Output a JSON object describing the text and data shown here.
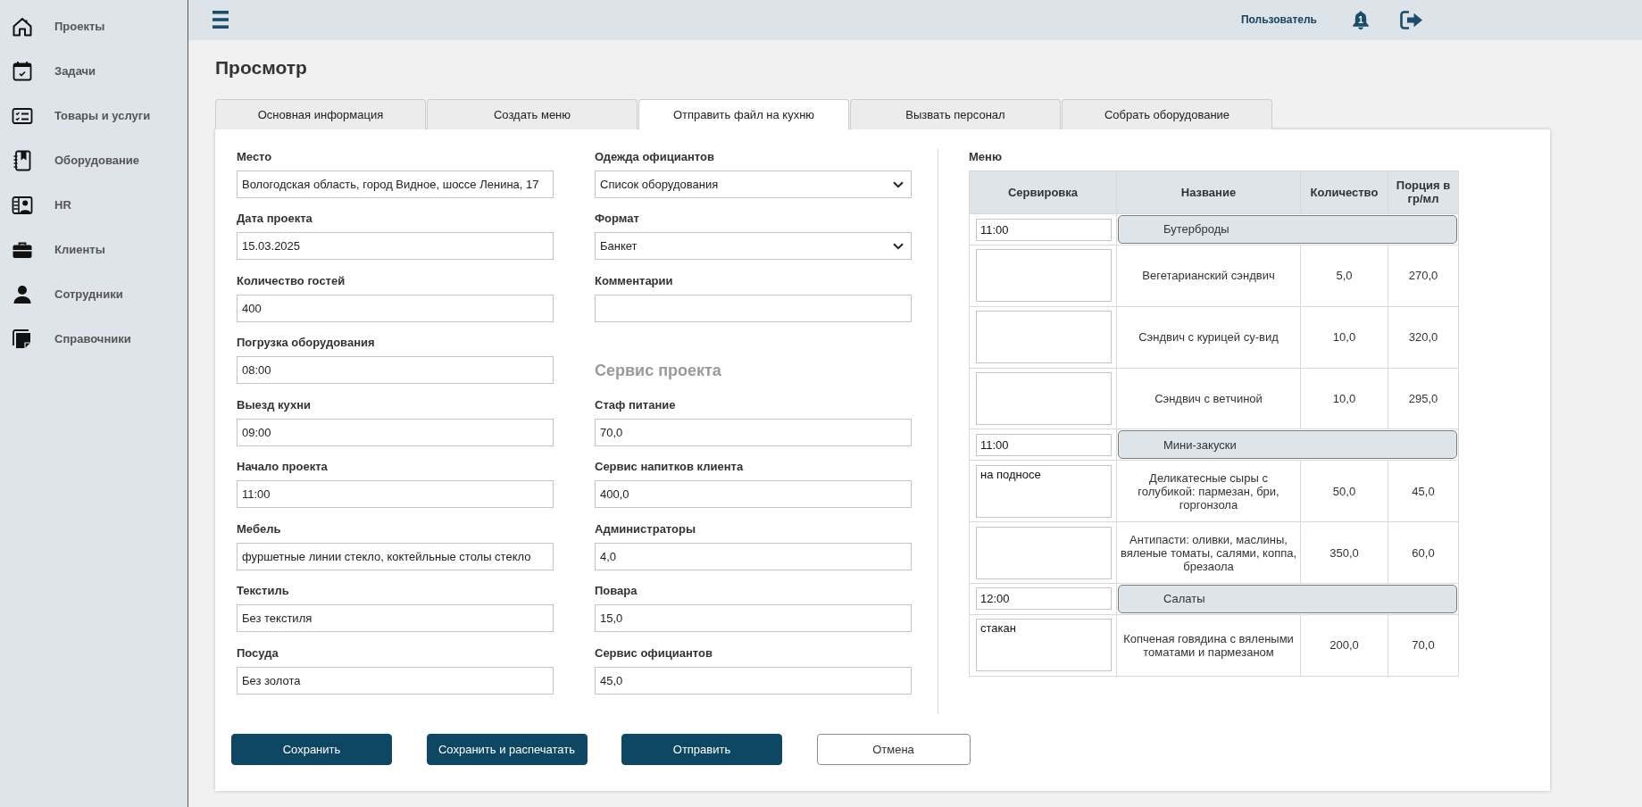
{
  "sidebar": {
    "items": [
      {
        "label": "Проекты"
      },
      {
        "label": "Задачи"
      },
      {
        "label": "Товары и услуги"
      },
      {
        "label": "Оборудование"
      },
      {
        "label": "HR"
      },
      {
        "label": "Клиенты"
      },
      {
        "label": "Сотрудники"
      },
      {
        "label": "Справочники"
      }
    ]
  },
  "topbar": {
    "user": "Пользователь",
    "notifications": "1"
  },
  "page": {
    "title": "Просмотр"
  },
  "tabs": [
    {
      "label": "Основная информация",
      "selected": false
    },
    {
      "label": "Создать меню",
      "selected": false
    },
    {
      "label": "Отправить файл на кухню",
      "selected": true
    },
    {
      "label": "Вызвать персонал",
      "selected": false
    },
    {
      "label": "Собрать оборудование",
      "selected": false
    }
  ],
  "form": {
    "columns": [
      {
        "fields": [
          {
            "kind": "input",
            "label": "Место",
            "value": "Вологодская область, город Видное, шоссе Ленина, 17"
          },
          {
            "kind": "input",
            "label": "Дата проекта",
            "value": "15.03.2025"
          },
          {
            "kind": "input",
            "label": "Количество гостей",
            "value": "400"
          },
          {
            "kind": "input",
            "label": "Погрузка оборудования",
            "value": "08:00"
          },
          {
            "kind": "input",
            "label": "Выезд кухни",
            "value": "09:00"
          },
          {
            "kind": "input",
            "label": "Начало проекта",
            "value": "11:00"
          },
          {
            "kind": "input",
            "label": "Мебель",
            "value": "фуршетные линии стекло, коктейльные столы стекло"
          },
          {
            "kind": "input",
            "label": "Текстиль",
            "value": "Без текстиля"
          },
          {
            "kind": "input",
            "label": "Посуда",
            "value": "Без золота"
          }
        ]
      },
      {
        "fields": [
          {
            "kind": "select",
            "label": "Одежда официантов",
            "value": "Список оборудования"
          },
          {
            "kind": "select",
            "label": "Формат",
            "value": "Банкет"
          },
          {
            "kind": "input",
            "label": "Комментарии"
          },
          {
            "kind": "heading",
            "label": "Сервис проекта"
          },
          {
            "kind": "input",
            "label": "Стаф питание",
            "value": "70,0"
          },
          {
            "kind": "input",
            "label": "Сервис напитков клиента",
            "value": "400,0"
          },
          {
            "kind": "input",
            "label": "Администраторы",
            "value": "4,0"
          },
          {
            "kind": "input",
            "label": "Повара",
            "value": "15,0"
          },
          {
            "kind": "input",
            "label": "Сервис официантов",
            "value": "45,0"
          }
        ]
      }
    ]
  },
  "menu": {
    "title": "Меню",
    "columns": [
      "Сервировка",
      "Название",
      "Количество",
      "Порция в гр/мл"
    ],
    "groups": [
      {
        "time": "11:00",
        "name": "Бутерброды",
        "items": [
          {
            "name": "Вегетарианский сэндвич",
            "quantity": "5,0",
            "portion": "270,0"
          },
          {
            "name": "Сэндвич с курицей су-вид",
            "quantity": "10,0",
            "portion": "320,0"
          },
          {
            "name": "Сэндвич с ветчиной",
            "quantity": "10,0",
            "portion": "295,0"
          }
        ]
      },
      {
        "time": "11:00",
        "name": "Мини-закуски",
        "items": [
          {
            "serving": "на подносе",
            "name": "Деликатесные сыры с голубикой: пармезан, бри, горгонзола",
            "quantity": "50,0",
            "portion": "45,0"
          },
          {
            "name": "Антипасти: оливки, маслины, вяленые томаты, салями, коппа, брезаола",
            "quantity": "350,0",
            "portion": "60,0"
          }
        ]
      },
      {
        "time": "12:00",
        "name": "Салаты",
        "items": [
          {
            "serving": "стакан",
            "name": "Копченая говядина с вялеными томатами и пармезаном",
            "quantity": "200,0",
            "portion": "70,0"
          }
        ]
      }
    ]
  },
  "buttons": [
    {
      "label": "Сохранить",
      "kind": "primary"
    },
    {
      "label": "Сохранить и распечатать",
      "kind": "primary"
    },
    {
      "label": "Отправить",
      "kind": "primary"
    },
    {
      "label": "Отмена",
      "kind": "outline"
    }
  ]
}
